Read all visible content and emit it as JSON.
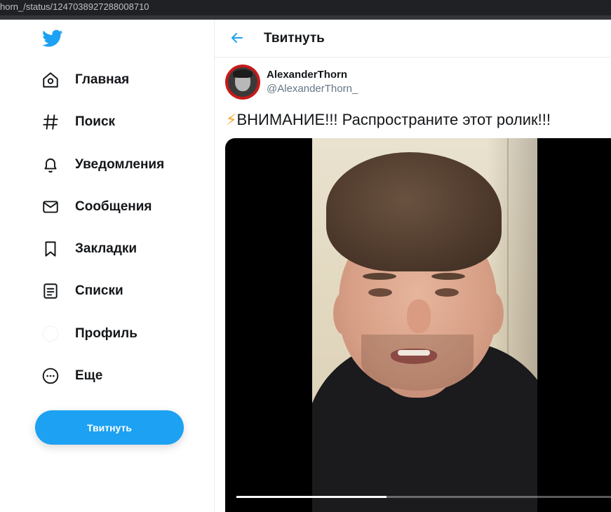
{
  "browser": {
    "url": "horn_/status/1247038927288008710"
  },
  "sidebar": {
    "items": [
      {
        "label": "Главная",
        "icon": "home-icon"
      },
      {
        "label": "Поиск",
        "icon": "hashtag-icon"
      },
      {
        "label": "Уведомления",
        "icon": "bell-icon"
      },
      {
        "label": "Сообщения",
        "icon": "mail-icon"
      },
      {
        "label": "Закладки",
        "icon": "bookmark-icon"
      },
      {
        "label": "Списки",
        "icon": "list-icon"
      },
      {
        "label": "Профиль",
        "icon": "profile-icon"
      },
      {
        "label": "Еще",
        "icon": "more-icon"
      }
    ],
    "tweet_button": "Твитнуть"
  },
  "header": {
    "title": "Твитнуть"
  },
  "tweet": {
    "author_name": "AlexanderThorn",
    "author_handle": "@AlexanderThorn_",
    "emoji": "⚡",
    "text": "ВНИМАНИЕ!!! Распространите этот ролик!!!",
    "video": {
      "progress": 0.4
    }
  },
  "colors": {
    "accent": "#1da1f2",
    "bolt": "#f5a623"
  }
}
